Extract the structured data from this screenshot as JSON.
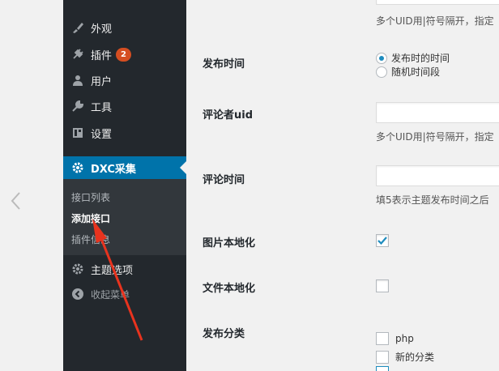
{
  "sidebar": {
    "items": [
      {
        "label": "外观",
        "icon": "paintbrush-icon"
      },
      {
        "label": "插件",
        "icon": "plugin-icon",
        "badge": "2"
      },
      {
        "label": "用户",
        "icon": "user-icon"
      },
      {
        "label": "工具",
        "icon": "wrench-icon"
      },
      {
        "label": "设置",
        "icon": "settings-icon"
      }
    ],
    "active": {
      "label": "DXC采集",
      "icon": "gear-icon"
    },
    "submenu": [
      {
        "label": "接口列表"
      },
      {
        "label": "添加接口",
        "current": true
      },
      {
        "label": "插件信息"
      }
    ],
    "theme_options": {
      "label": "主题选项",
      "icon": "gear-icon"
    },
    "collapse": {
      "label": "收起菜单",
      "icon": "collapse-icon"
    }
  },
  "form": {
    "top_desc": "多个UID用|符号隔开，指定",
    "publish_time": {
      "label": "发布时间",
      "options": [
        {
          "label": "发布时的时间",
          "checked": true
        },
        {
          "label": "随机时间段",
          "checked": false
        }
      ]
    },
    "commenter_uid": {
      "label": "评论者uid",
      "value": "",
      "desc": "多个UID用|符号隔开，指定"
    },
    "comment_time": {
      "label": "评论时间",
      "value": "",
      "desc": "填5表示主题发布时间之后"
    },
    "image_localize": {
      "label": "图片本地化",
      "checked": true
    },
    "file_localize": {
      "label": "文件本地化",
      "checked": false
    },
    "publish_category": {
      "label": "发布分类",
      "options": [
        {
          "label": "php",
          "checked": false
        },
        {
          "label": "新的分类",
          "checked": false
        }
      ]
    }
  },
  "colors": {
    "sidebar_bg": "#23282d",
    "submenu_bg": "#32373c",
    "active_bg": "#0073aa",
    "badge_bg": "#d54e21",
    "annotation_arrow": "#e8331e",
    "checkmark": "#1e8cbe"
  }
}
